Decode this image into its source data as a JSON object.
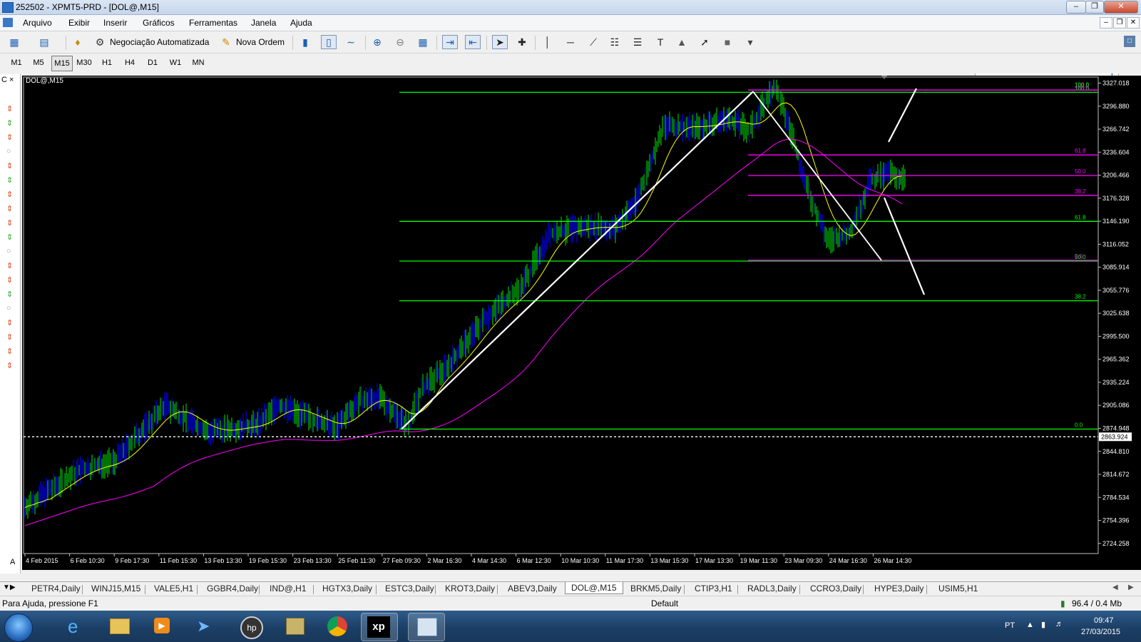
{
  "window": {
    "title": "252502 - XPMT5-PRD - [DOL@,M15]"
  },
  "menu": [
    "Arquivo",
    "Exibir",
    "Inserir",
    "Gráficos",
    "Ferramentas",
    "Janela",
    "Ajuda"
  ],
  "toolbar": {
    "algo_label": "Negociação Automatizada",
    "new_order_label": "Nova Ordem"
  },
  "timeframes": [
    "M1",
    "M5",
    "M15",
    "M30",
    "H1",
    "H4",
    "D1",
    "W1",
    "MN"
  ],
  "active_timeframe": "M15",
  "chart": {
    "symbol_label": "DOL@,M15",
    "price_ticks": [
      "3327.018",
      "3296.880",
      "3266.742",
      "3236.604",
      "3206.466",
      "3176.328",
      "3146.190",
      "3116.052",
      "3085.914",
      "3055.776",
      "3025.638",
      "2995.500",
      "2965.362",
      "2935.224",
      "2905.086",
      "2874.948",
      "2844.810",
      "2814.672",
      "2784.534",
      "2754.396",
      "2724.258"
    ],
    "price_min": 2711.0,
    "price_max": 3335.0,
    "current_price": "2863.924",
    "time_ticks": [
      "4 Feb 2015",
      "6 Feb 10:30",
      "9 Feb 17:30",
      "11 Feb 15:30",
      "13 Feb 13:30",
      "19 Feb 15:30",
      "23 Feb 13:30",
      "25 Feb 11:30",
      "27 Feb 09:30",
      "2 Mar 16:30",
      "4 Mar 14:30",
      "6 Mar 12:30",
      "10 Mar 10:30",
      "11 Mar 17:30",
      "13 Mar 15:30",
      "17 Mar 13:30",
      "19 Mar 11:30",
      "23 Mar 09:30",
      "24 Mar 16:30",
      "26 Mar 14:30"
    ],
    "fibo_green": [
      {
        "label": "100.0",
        "price": 3315.0
      },
      {
        "label": "61.8",
        "price": 3146.0
      },
      {
        "label": "50.0",
        "price": 3094.0
      },
      {
        "label": "38.2",
        "price": 3042.0
      },
      {
        "label": "0.0",
        "price": 2874.0
      }
    ],
    "fibo_magenta": [
      {
        "label": "100.0",
        "price": 3318.0
      },
      {
        "label": "61.8",
        "price": 3233.0
      },
      {
        "label": "50.0",
        "price": 3206.0
      },
      {
        "label": "38.2",
        "price": 3180.0
      },
      {
        "label": "0.0",
        "price": 3095.0
      }
    ],
    "fibo_green_marker": "100.0",
    "colors": {
      "background": "#000000",
      "up_bar": "#00c000",
      "down_bar": "#0000ff",
      "ma_fast": "#ffff00",
      "ma_slow": "#ff00ff",
      "fibo_green": "#00ff00",
      "fibo_magenta": "#ff00ff",
      "trend": "#ffffff"
    }
  },
  "symbol_tabs": [
    "PETR4,Daily",
    "WINJ15,M15",
    "VALE5,H1",
    "GGBR4,Daily",
    "IND@,H1",
    "HGTX3,Daily",
    "ESTC3,Daily",
    "KROT3,Daily",
    "ABEV3,Daily",
    "DOL@,M15",
    "BRKM5,Daily",
    "CTIP3,H1",
    "RADL3,Daily",
    "CCRO3,Daily",
    "HYPE3,Daily",
    "USIM5,H1"
  ],
  "active_tab": "DOL@,M15",
  "status": {
    "help": "Para Ajuda, pressione F1",
    "profile": "Default",
    "traffic": "96.4 / 0.4 Mb"
  },
  "taskbar": {
    "language": "PT",
    "time": "09:47",
    "date": "27/03/2015"
  },
  "icons": {
    "search": "search-icon",
    "start": "windows-start-icon"
  }
}
